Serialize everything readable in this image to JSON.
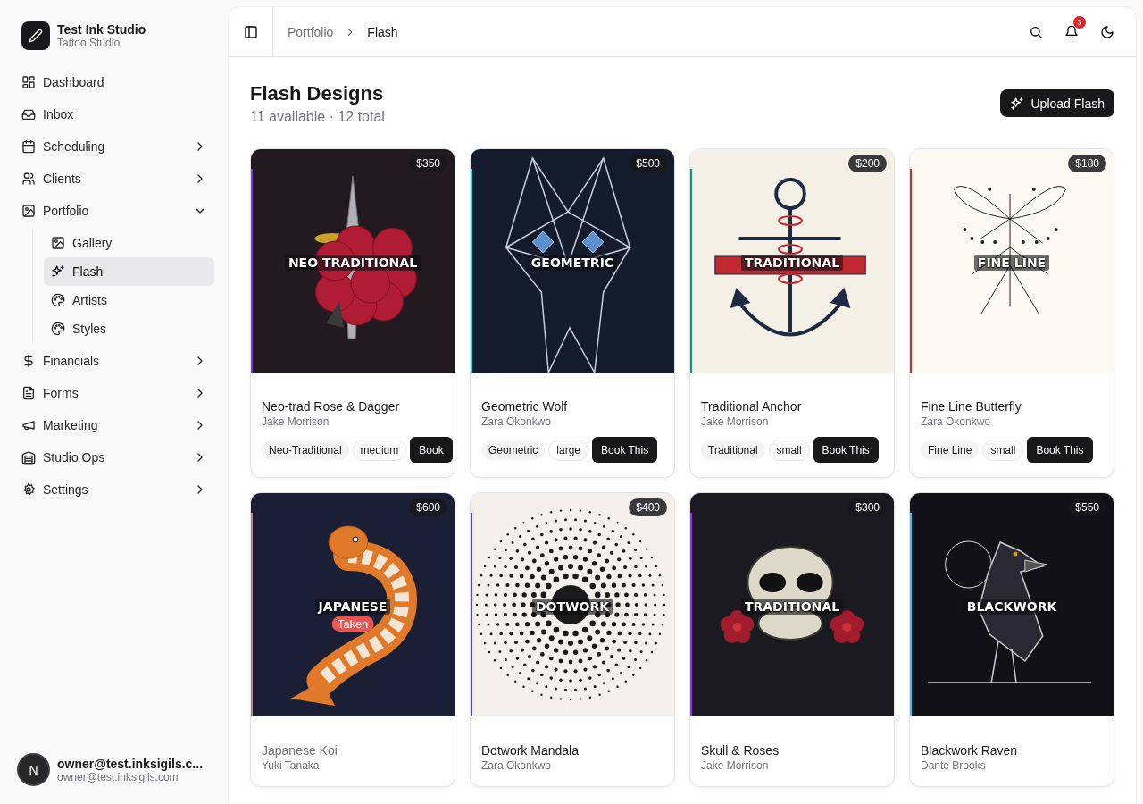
{
  "brand": {
    "name": "Test Ink Studio",
    "subtitle": "Tattoo Studio"
  },
  "sidebar": {
    "items": [
      {
        "label": "Dashboard",
        "selected": false
      },
      {
        "label": "Inbox",
        "selected": false
      },
      {
        "label": "Scheduling",
        "selected": false,
        "expanded": false
      },
      {
        "label": "Clients",
        "selected": false,
        "expanded": false
      },
      {
        "label": "Portfolio",
        "selected": false,
        "expanded": true,
        "children": [
          {
            "label": "Gallery",
            "selected": false
          },
          {
            "label": "Flash",
            "selected": true
          },
          {
            "label": "Artists",
            "selected": false
          },
          {
            "label": "Styles",
            "selected": false
          }
        ]
      },
      {
        "label": "Financials",
        "selected": false,
        "expanded": false
      },
      {
        "label": "Forms",
        "selected": false,
        "expanded": false
      },
      {
        "label": "Marketing",
        "selected": false,
        "expanded": false
      },
      {
        "label": "Studio Ops",
        "selected": false,
        "expanded": false
      },
      {
        "label": "Settings",
        "selected": false,
        "expanded": false
      }
    ]
  },
  "user": {
    "initial": "N",
    "name": "owner@test.inksigils.c...",
    "email": "owner@test.inksigils.com"
  },
  "breadcrumb": [
    "Portfolio",
    "Flash"
  ],
  "notifications": {
    "count": "3"
  },
  "page": {
    "title": "Flash Designs",
    "subtitle": "11 available · 12 total",
    "action": "Upload Flash"
  },
  "designs": [
    {
      "art_label": "NEO TRADITIONAL",
      "price": "$350",
      "available": true,
      "color": "#7c3aed",
      "title": "Neo-trad Rose & Dagger",
      "artist": "Jake Morrison",
      "tags": [
        "Neo-Traditional",
        "medium"
      ],
      "button": "Book"
    },
    {
      "art_label": "GEOMETRIC",
      "price": "$500",
      "available": true,
      "color": "#22d3ee",
      "title": "Geometric Wolf",
      "artist": "Zara Okonkwo",
      "tags": [
        "Geometric",
        "large"
      ],
      "button": "Book This"
    },
    {
      "art_label": "TRADITIONAL",
      "price": "$200",
      "available": true,
      "color": "#0d9488",
      "title": "Traditional Anchor",
      "artist": "Jake Morrison",
      "tags": [
        "Traditional",
        "small"
      ],
      "button": "Book This"
    },
    {
      "art_label": "FINE LINE",
      "price": "$180",
      "available": true,
      "color": "#dc2626",
      "title": "Fine Line Butterfly",
      "artist": "Zara Okonkwo",
      "tags": [
        "Fine Line",
        "small"
      ],
      "button": "Book This"
    },
    {
      "art_label": "JAPANESE",
      "price": "$600",
      "available": false,
      "status": "Taken",
      "color": "#be7c8c",
      "title": "Japanese Koi",
      "artist": "Yuki Tanaka"
    },
    {
      "art_label": "DOTWORK",
      "price": "$400",
      "available": true,
      "color": "#4f46e5",
      "title": "Dotwork Mandala",
      "artist": "Zara Okonkwo"
    },
    {
      "art_label": "TRADITIONAL",
      "price": "$300",
      "available": true,
      "color": "#9333ea",
      "title": "Skull & Roses",
      "artist": "Jake Morrison"
    },
    {
      "art_label": "BLACKWORK",
      "price": "$550",
      "available": true,
      "color": "#38bdf8",
      "title": "Blackwork Raven",
      "artist": "Dante Brooks"
    }
  ]
}
